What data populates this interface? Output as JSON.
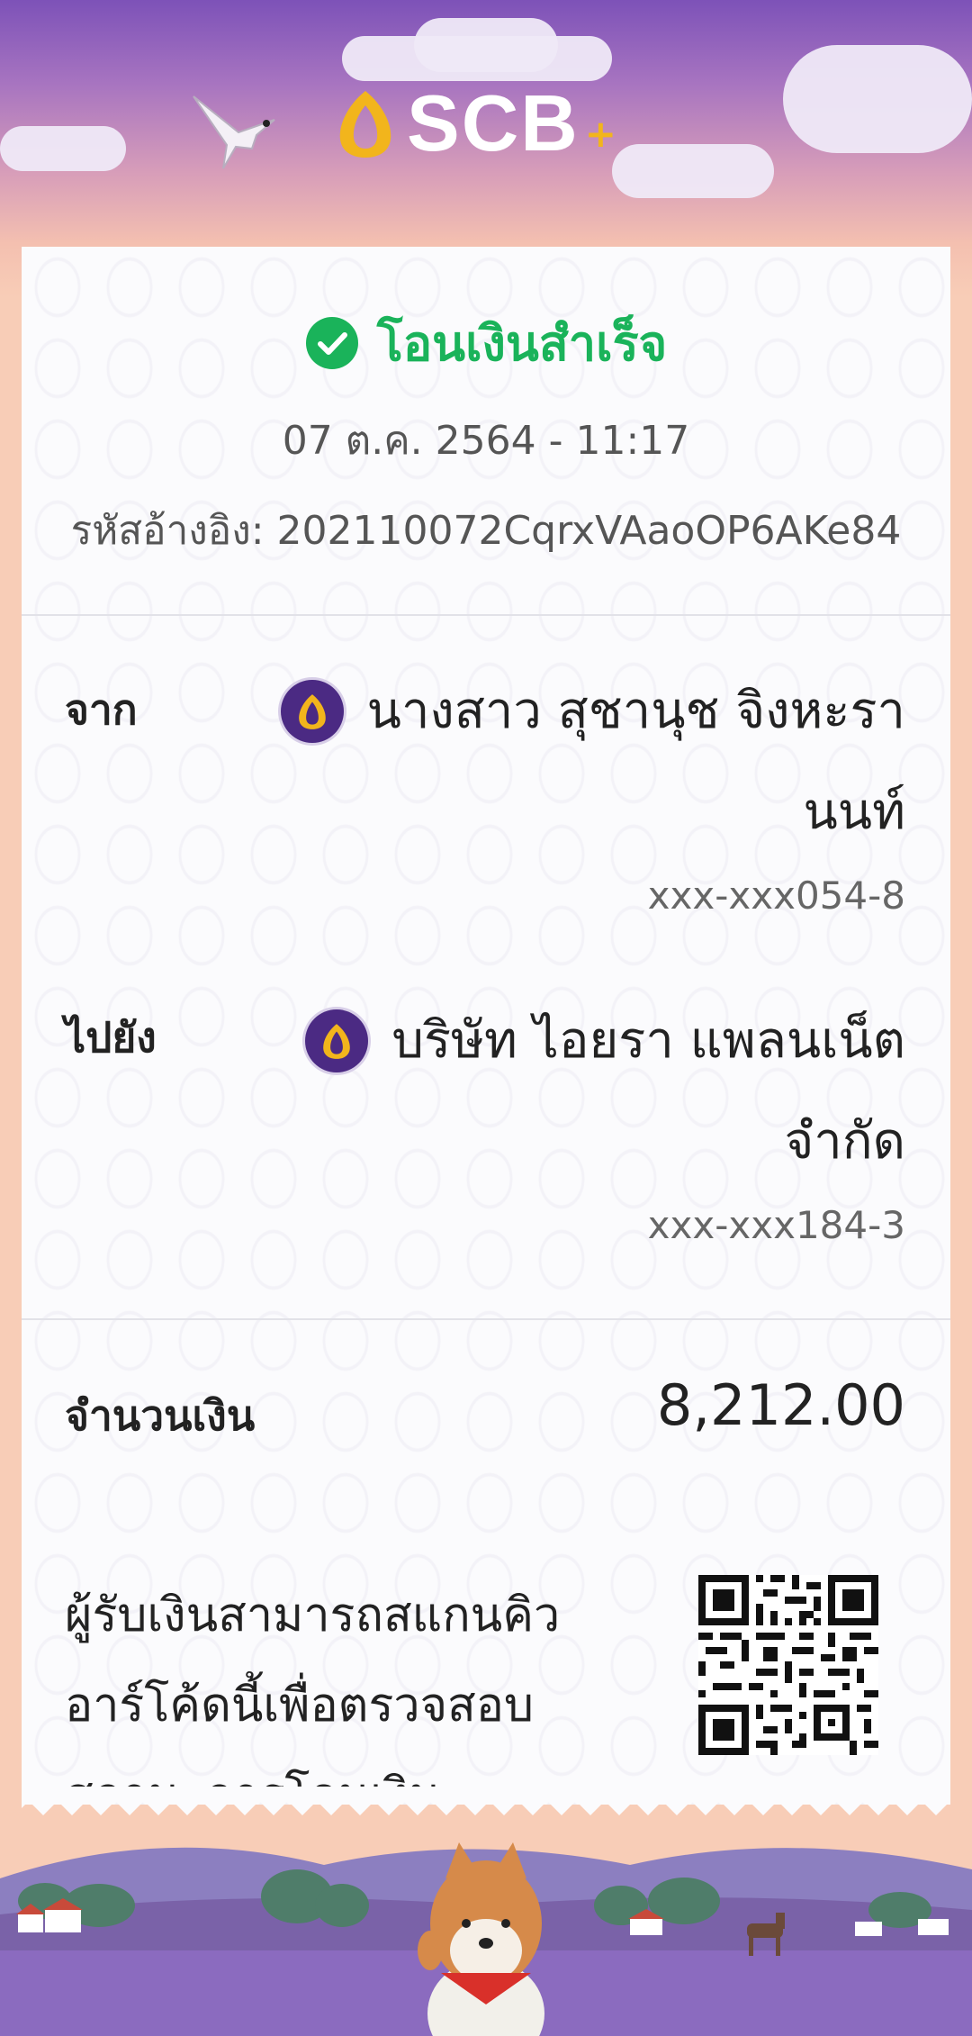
{
  "header": {
    "brand": "SCB",
    "brand_mark": "+"
  },
  "status": {
    "text": "โอนเงินสำเร็จ",
    "color": "#1ab35a"
  },
  "datetime": "07 ต.ค. 2564 - 11:17",
  "reference": {
    "label": "รหัสอ้างอิง:",
    "value": "202110072CqrxVAaoOP6AKe84"
  },
  "from": {
    "label": "จาก",
    "name_line1": "นางสาว สุชานุช จิงหะรา",
    "name_line2": "นนท์",
    "account": "xxx-xxx054-8"
  },
  "to": {
    "label": "ไปยัง",
    "name_line1": "บริษัท ไอยรา แพลนเน็ต",
    "name_line2": "จำกัด",
    "account": "xxx-xxx184-3"
  },
  "amount": {
    "label": "จำนวนเงิน",
    "value": "8,212.00"
  },
  "note": {
    "line1": "ผู้รับเงินสามารถสแกนคิว",
    "line2": "อาร์โค้ดนี้เพื่อตรวจสอบ",
    "line3": "สถานะการโอนเงิน"
  },
  "colors": {
    "brand_purple": "#4b2a83",
    "brand_gold": "#f2b51c",
    "success": "#1ab35a"
  }
}
